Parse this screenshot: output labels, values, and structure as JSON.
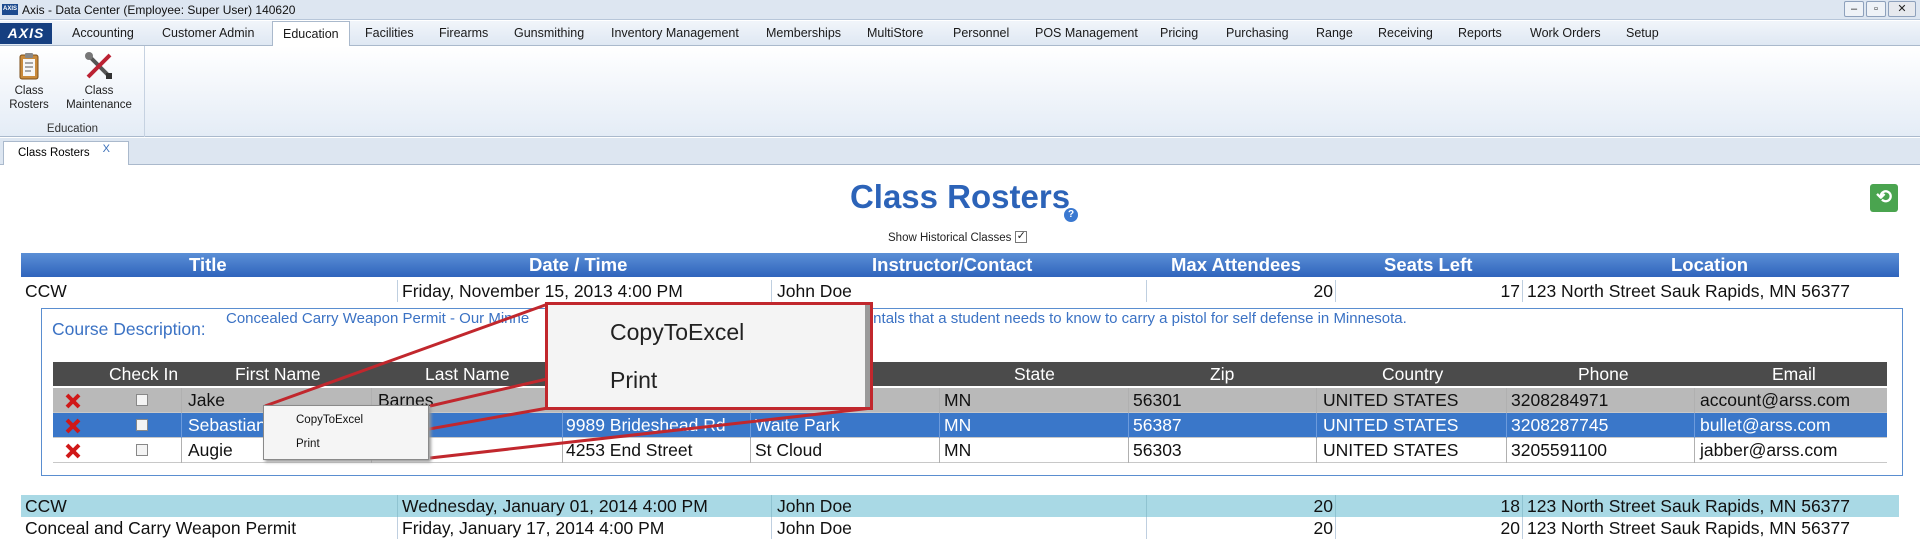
{
  "window": {
    "title": "Axis - Data Center  (Employee: Super User) 140620",
    "app_icon_text": "AXIS"
  },
  "menu": {
    "logo": "AXIS",
    "items": [
      "Accounting",
      "Customer Admin",
      "Education",
      "Facilities",
      "Firearms",
      "Gunsmithing",
      "Inventory Management",
      "Memberships",
      "MultiStore",
      "Personnel",
      "POS Management",
      "Pricing",
      "Purchasing",
      "Range",
      "Receiving",
      "Reports",
      "Work Orders",
      "Setup"
    ],
    "active": "Education"
  },
  "ribbon": {
    "buttons": [
      {
        "line1": "Class",
        "line2": "Rosters",
        "icon": "clipboard-icon"
      },
      {
        "line1": "Class",
        "line2": "Maintenance",
        "icon": "tools-icon"
      }
    ],
    "group_label": "Education"
  },
  "doc_tab": {
    "label": "Class Rosters",
    "close": "X"
  },
  "page": {
    "title": "Class Rosters",
    "historical_label": "Show Historical Classes",
    "historical_checked": true,
    "help": "?",
    "refresh_icon": "refresh-icon"
  },
  "grid": {
    "headers": [
      "Title",
      "Date / Time",
      "Instructor/Contact",
      "Max Attendees",
      "Seats Left",
      "Location"
    ],
    "rows": [
      {
        "title": "CCW",
        "datetime": "Friday, November 15, 2013 4:00 PM",
        "instructor": "John Doe",
        "max": "20",
        "seats": "17",
        "location": "123 North Street Sauk Rapids, MN 56377"
      },
      {
        "title": "CCW",
        "datetime": "Wednesday, January 01, 2014 4:00 PM",
        "instructor": "John Doe",
        "max": "20",
        "seats": "18",
        "location": "123 North Street Sauk Rapids, MN 56377"
      },
      {
        "title": "Conceal and Carry Weapon Permit",
        "datetime": "Friday, January 17, 2014 4:00 PM",
        "instructor": "John Doe",
        "max": "20",
        "seats": "20",
        "location": "123 North Street Sauk Rapids, MN 56377"
      }
    ]
  },
  "detail": {
    "course_desc_label": "Course Description:",
    "course_desc_visible_left": "Concealed Carry Weapon Permit - Our Minne",
    "course_desc_visible_right": "amentals that a student needs to know to carry a pistol for self defense in Minnesota.",
    "headers": [
      "Check In",
      "First Name",
      "Last Name",
      "State",
      "Zip",
      "Country",
      "Phone",
      "Email"
    ],
    "attendees": [
      {
        "first": "Jake",
        "last": "Barnes",
        "address": "",
        "city": "",
        "state": "MN",
        "zip": "56301",
        "country": "UNITED STATES",
        "phone": "3208284971",
        "email": "account@arss.com"
      },
      {
        "first": "Sebastian",
        "last": "",
        "address": "9989 Brideshead Rd",
        "city": "Waite Park",
        "state": "MN",
        "zip": "56387",
        "country": "UNITED STATES",
        "phone": "3208287745",
        "email": "bullet@arss.com"
      },
      {
        "first": "Augie",
        "last": "",
        "address": "4253 End Street",
        "city": "St Cloud",
        "state": "MN",
        "zip": "56303",
        "country": "UNITED STATES",
        "phone": "3205591100",
        "email": "jabber@arss.com"
      }
    ]
  },
  "context_menu": {
    "items": [
      "CopyToExcel",
      "Print"
    ]
  },
  "colors": {
    "accent": "#2c63b8",
    "header_grad_top": "#5b8fd6",
    "header_grad_bottom": "#2f64bc",
    "selected_row": "#3a77c9",
    "gray_row": "#b9b9b9",
    "alt_row": "#a9d9e5",
    "callout": "#c1272d"
  }
}
